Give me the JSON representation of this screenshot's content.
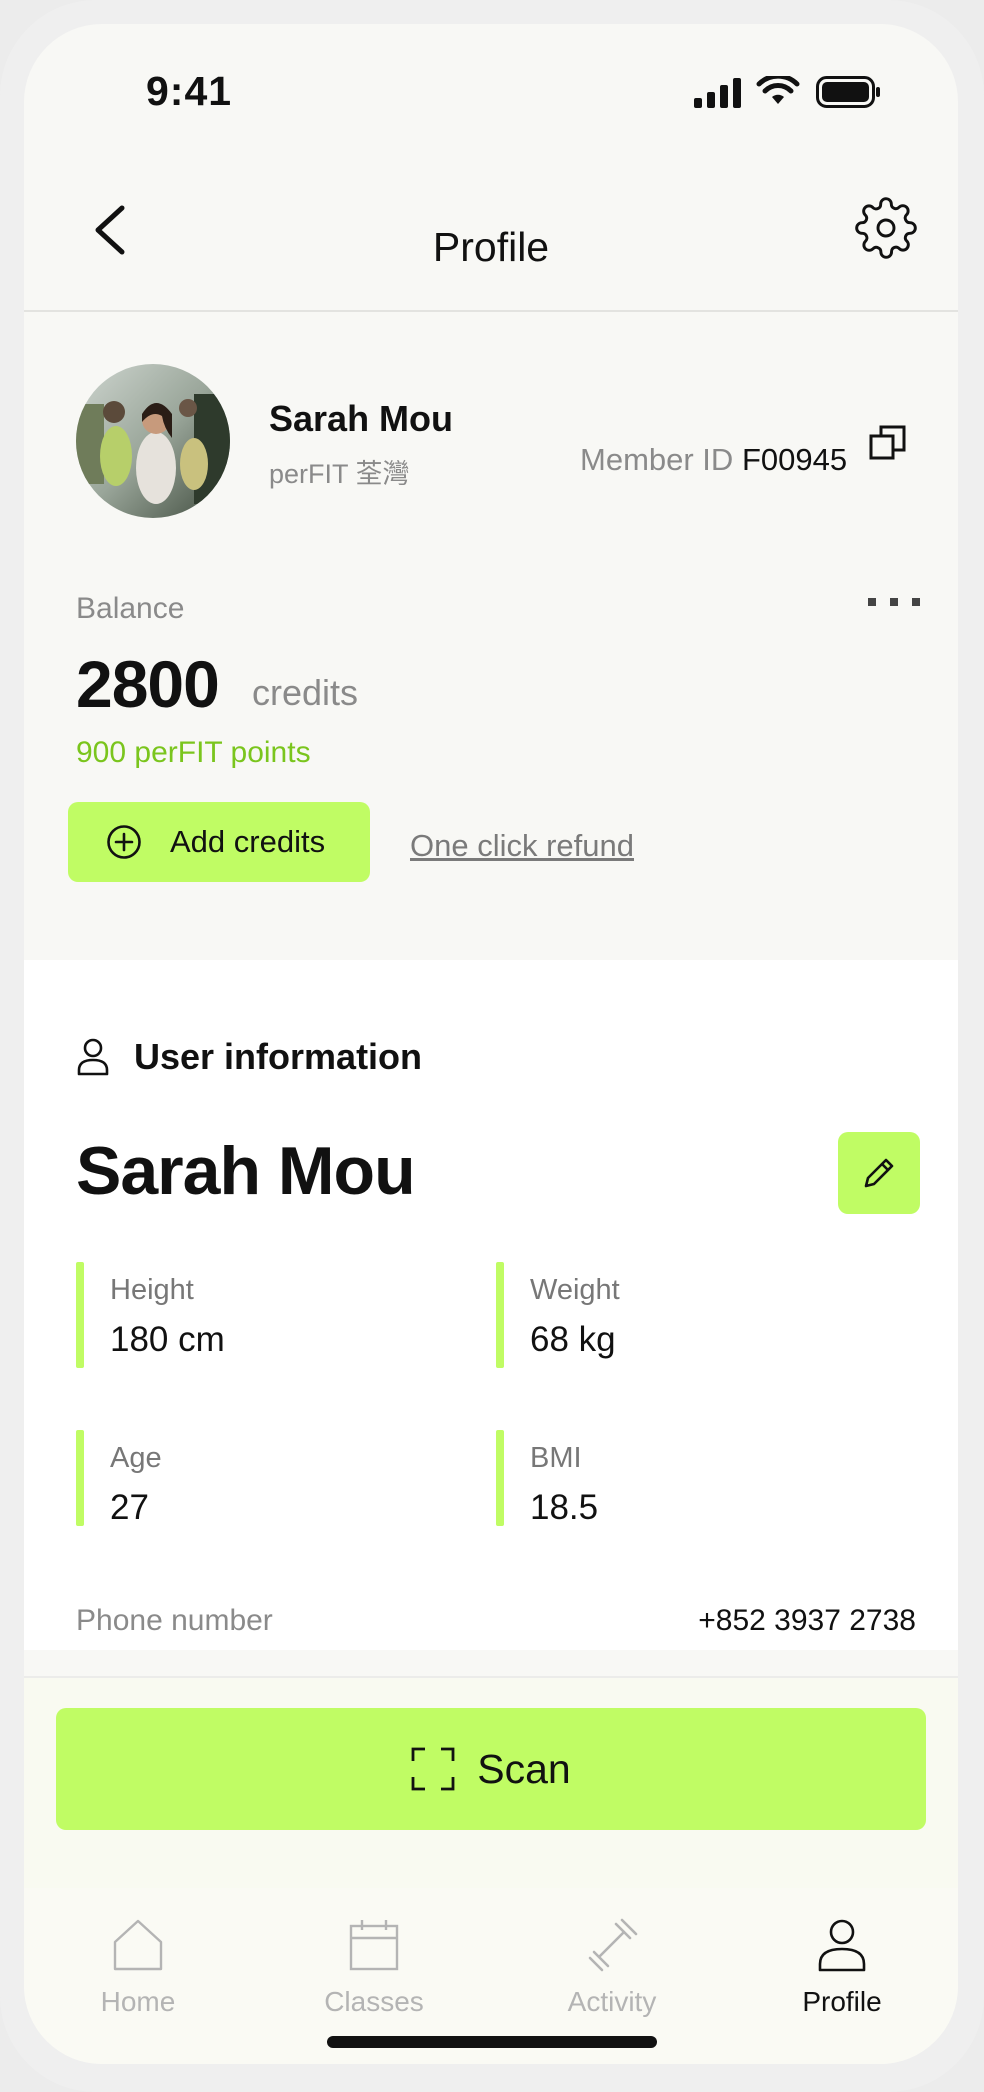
{
  "status_bar": {
    "time": "9:41"
  },
  "header": {
    "title": "Profile"
  },
  "profile": {
    "name": "Sarah Mou",
    "gym": "perFIT 荃灣",
    "member_id_label": "Member ID",
    "member_id": "F00945"
  },
  "balance": {
    "label": "Balance",
    "amount": "2800",
    "unit": "credits",
    "points": "900 perFIT points",
    "add_credits_label": "Add credits",
    "refund_label": "One click refund"
  },
  "user_info": {
    "section_title": "User information",
    "full_name": "Sarah Mou",
    "stats": [
      {
        "label": "Height",
        "value": "180 cm"
      },
      {
        "label": "Weight",
        "value": "68 kg"
      },
      {
        "label": "Age",
        "value": "27"
      },
      {
        "label": "BMI",
        "value": "18.5"
      }
    ],
    "phone_label": "Phone number",
    "phone_value": "+852 3937 2738"
  },
  "scan": {
    "label": "Scan"
  },
  "tabs": [
    {
      "label": "Home",
      "icon": "home-icon"
    },
    {
      "label": "Classes",
      "icon": "calendar-icon"
    },
    {
      "label": "Activity",
      "icon": "dumbbell-icon"
    },
    {
      "label": "Profile",
      "icon": "person-icon",
      "active": true
    }
  ],
  "colors": {
    "accent": "#c0fc64",
    "points_green": "#7ac51d",
    "muted_text": "#8a8a8a"
  }
}
